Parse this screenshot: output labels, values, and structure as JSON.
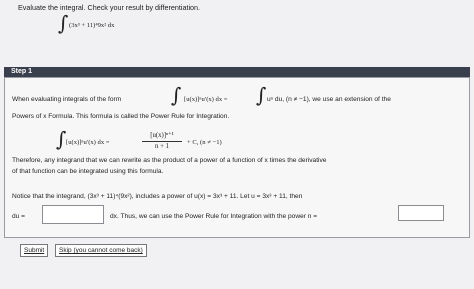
{
  "question": {
    "instruction": "Evaluate the integral. Check your result by differentiation.",
    "integral_symbol": "∫",
    "integrand": "(3x³ + 11)⁴9x² dx"
  },
  "step": {
    "label": "Step 1"
  },
  "content": {
    "line1_text": "When evaluating integrals of the form",
    "line1_form": "[u(x)]ⁿu′(x) dx =",
    "line1_rhs": "uⁿ du,  (n ≠ −1),  we use an extension of the",
    "line2_text": "Powers of x Formula. This formula is called the Power Rule for Integration.",
    "rule_lhs": "[u(x)]ⁿu′(x) dx =",
    "rule_numerator": "[u(x)]ⁿ⁺¹",
    "rule_denominator": "n + 1",
    "rule_tail": "+ C,  (n ≠ −1)",
    "line3_text": "Therefore, any integrand that we can rewrite as the product of a power of a function of x times the derivative",
    "line4_text": "of that function can be integrated using this formula.",
    "line5_text": "Notice that the integrand,  (3x³ + 11)⁴(9x²),  includes a power of  u(x) = 3x³ + 11.  Let  u = 3x³ + 11,  then",
    "du_label": "du =",
    "line6_text": "dx.  Thus, we can use the Power Rule for Integration with the power n ="
  },
  "inputs": {
    "du_value": "",
    "n_value": ""
  },
  "buttons": {
    "submit": "Submit",
    "skip": "Skip (you cannot come back)"
  }
}
